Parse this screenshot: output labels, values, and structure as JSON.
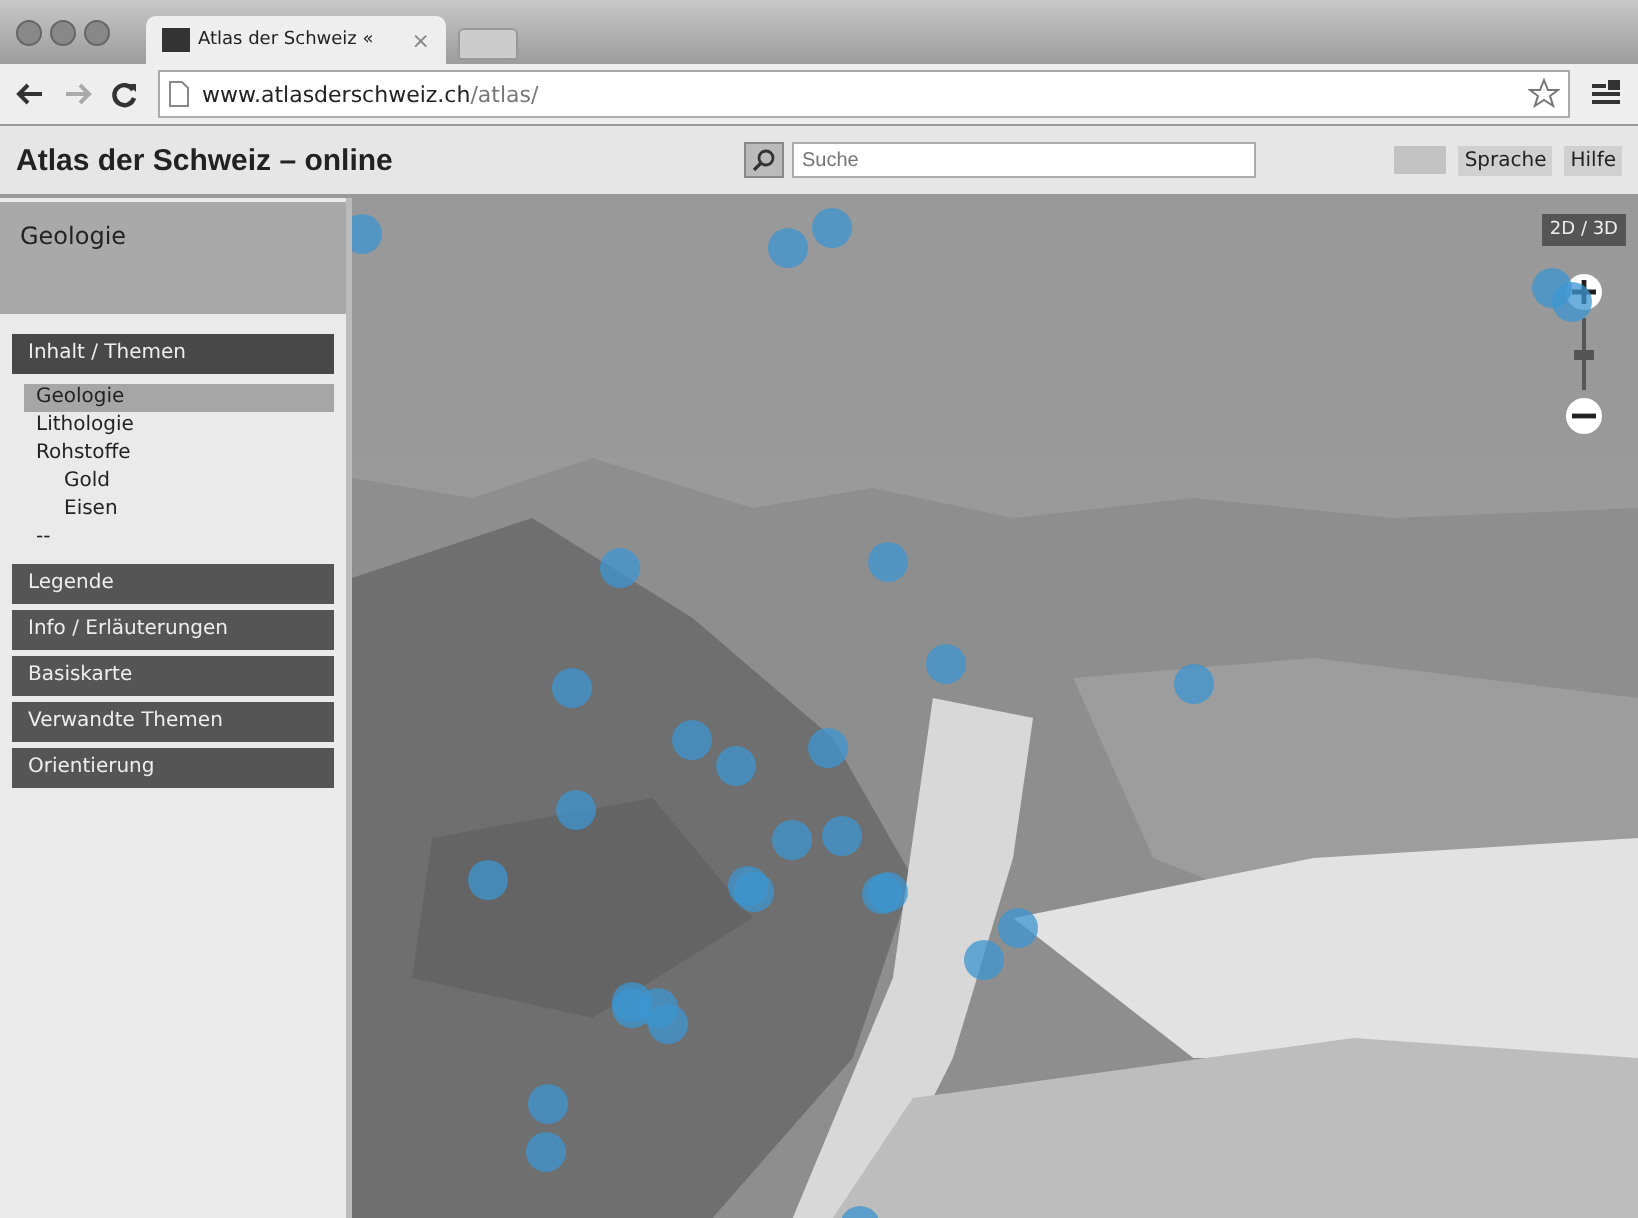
{
  "browser": {
    "tab_title": "Atlas der Schweiz «",
    "tab_close": "×",
    "url_host": "www.atlasderschweiz.ch",
    "url_path": "/atlas/"
  },
  "header": {
    "title": "Atlas der Schweiz – online",
    "search": {
      "placeholder": "Suche"
    },
    "buttons": [
      "Sprache",
      "Hilfe"
    ]
  },
  "sidebar": {
    "title": "Geologie",
    "sections": [
      {
        "label": "Inhalt / Themen",
        "expanded": true,
        "items": [
          {
            "label": "Geologie",
            "selected": true
          },
          {
            "label": "Lithologie",
            "selected": false
          },
          {
            "label": "Rohstoffe",
            "selected": false,
            "children": [
              {
                "label": "Gold",
                "selected": false
              },
              {
                "label": "Eisen",
                "selected": false
              }
            ]
          },
          {
            "label": "--",
            "selected": false
          }
        ]
      },
      {
        "label": "Legende",
        "expanded": false
      },
      {
        "label": "Info / Erläuterungen",
        "expanded": false
      },
      {
        "label": "Basiskarte",
        "expanded": false
      },
      {
        "label": "Verwandte Themen",
        "expanded": false
      },
      {
        "label": "Orientierung",
        "expanded": false
      }
    ]
  },
  "map": {
    "mode_button": "2D / 3D",
    "zoom": {
      "level": 0.5
    }
  }
}
